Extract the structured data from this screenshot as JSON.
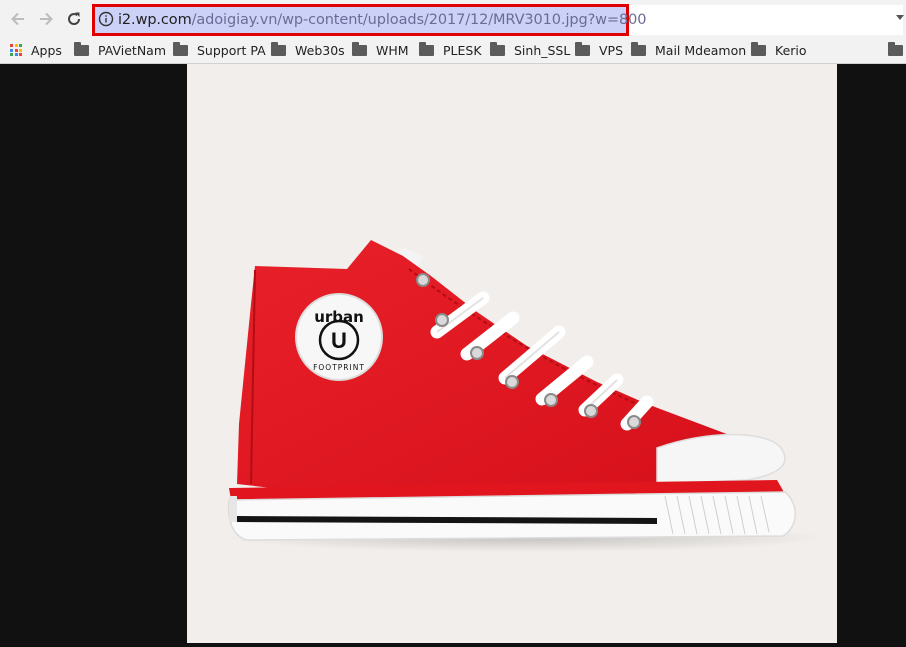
{
  "toolbar": {
    "back_icon": "arrow-left-icon",
    "forward_icon": "arrow-right-icon",
    "reload_icon": "reload-icon",
    "site_info_icon": "info-icon",
    "url_host": "i2.wp.com",
    "url_path": "/adoigiay.vn/wp-content/uploads/2017/12/MRV3010.jpg?w=800"
  },
  "bookmarks": {
    "apps_label": "Apps",
    "items": [
      {
        "label": "PAVietNam"
      },
      {
        "label": "Support PA"
      },
      {
        "label": "Web30s"
      },
      {
        "label": "WHM"
      },
      {
        "label": "PLESK"
      },
      {
        "label": "Sinh_SSL"
      },
      {
        "label": "VPS"
      },
      {
        "label": "Mail Mdeamon"
      },
      {
        "label": "Kerio"
      }
    ]
  },
  "image": {
    "logo_text_top": "urban",
    "logo_text_bottom": "FOOTPRINT",
    "logo_monogram": "U"
  },
  "colors": {
    "shoe_red": "#e1151d",
    "highlight_border": "#e00000",
    "image_background": "#f1eeeb",
    "viewer_background": "#111111"
  }
}
